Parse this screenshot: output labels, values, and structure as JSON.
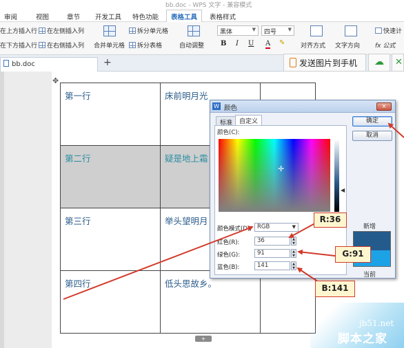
{
  "window": {
    "title": "bb.doc - WPS 文字 - 兼容模式"
  },
  "menu": {
    "tabs": [
      "审阅",
      "视图",
      "章节",
      "开发工具",
      "特色功能",
      "表格工具",
      "表格样式"
    ],
    "active": "表格工具"
  },
  "ribbon": {
    "insert_above": "在上方插入行",
    "insert_below": "在下方插入行",
    "insert_left": "在左侧插入列",
    "insert_right": "在右侧插入列",
    "merge_cells": "合并单元格",
    "split_cells": "拆分单元格",
    "split_table": "拆分表格",
    "auto_fit": "自动调整",
    "font_name": "黑体",
    "font_size": "四号",
    "bold": "B",
    "italic": "I",
    "underline": "U",
    "font_color": "A",
    "align": "对齐方式",
    "text_direction": "文字方向",
    "quick_calc": "快速计",
    "formula": "fx 公式"
  },
  "tabbar": {
    "doc_tab": "bb.doc",
    "new_tab": "+",
    "send_to_phone": "发送图片到手机"
  },
  "table": {
    "rows": [
      [
        "第一行",
        "床前明月光",
        ""
      ],
      [
        "第二行",
        "疑是地上霜",
        ""
      ],
      [
        "第三行",
        "举头望明月",
        ""
      ],
      [
        "第四行",
        "低头思故乡。",
        ""
      ]
    ],
    "shaded_row": 1
  },
  "dialog": {
    "title": "颜色",
    "close": "×",
    "tab_standard": "标准",
    "tab_custom": "自定义",
    "colors_label": "颜色(C):",
    "mode_label": "颜色模式(D):",
    "mode_value": "RGB",
    "red_label": "红色(R):",
    "green_label": "绿色(G):",
    "blue_label": "蓝色(B):",
    "red": "36",
    "green": "91",
    "blue": "141",
    "ok": "确定",
    "cancel": "取消",
    "new_label": "新增",
    "current_label": "当前",
    "new_color": "#245B8D",
    "current_color": "#1EA2E6"
  },
  "callouts": {
    "red": "R:36",
    "green": "G:91",
    "blue": "B:141"
  },
  "watermark": {
    "site": "jb51.net",
    "name": "脚本之家"
  }
}
